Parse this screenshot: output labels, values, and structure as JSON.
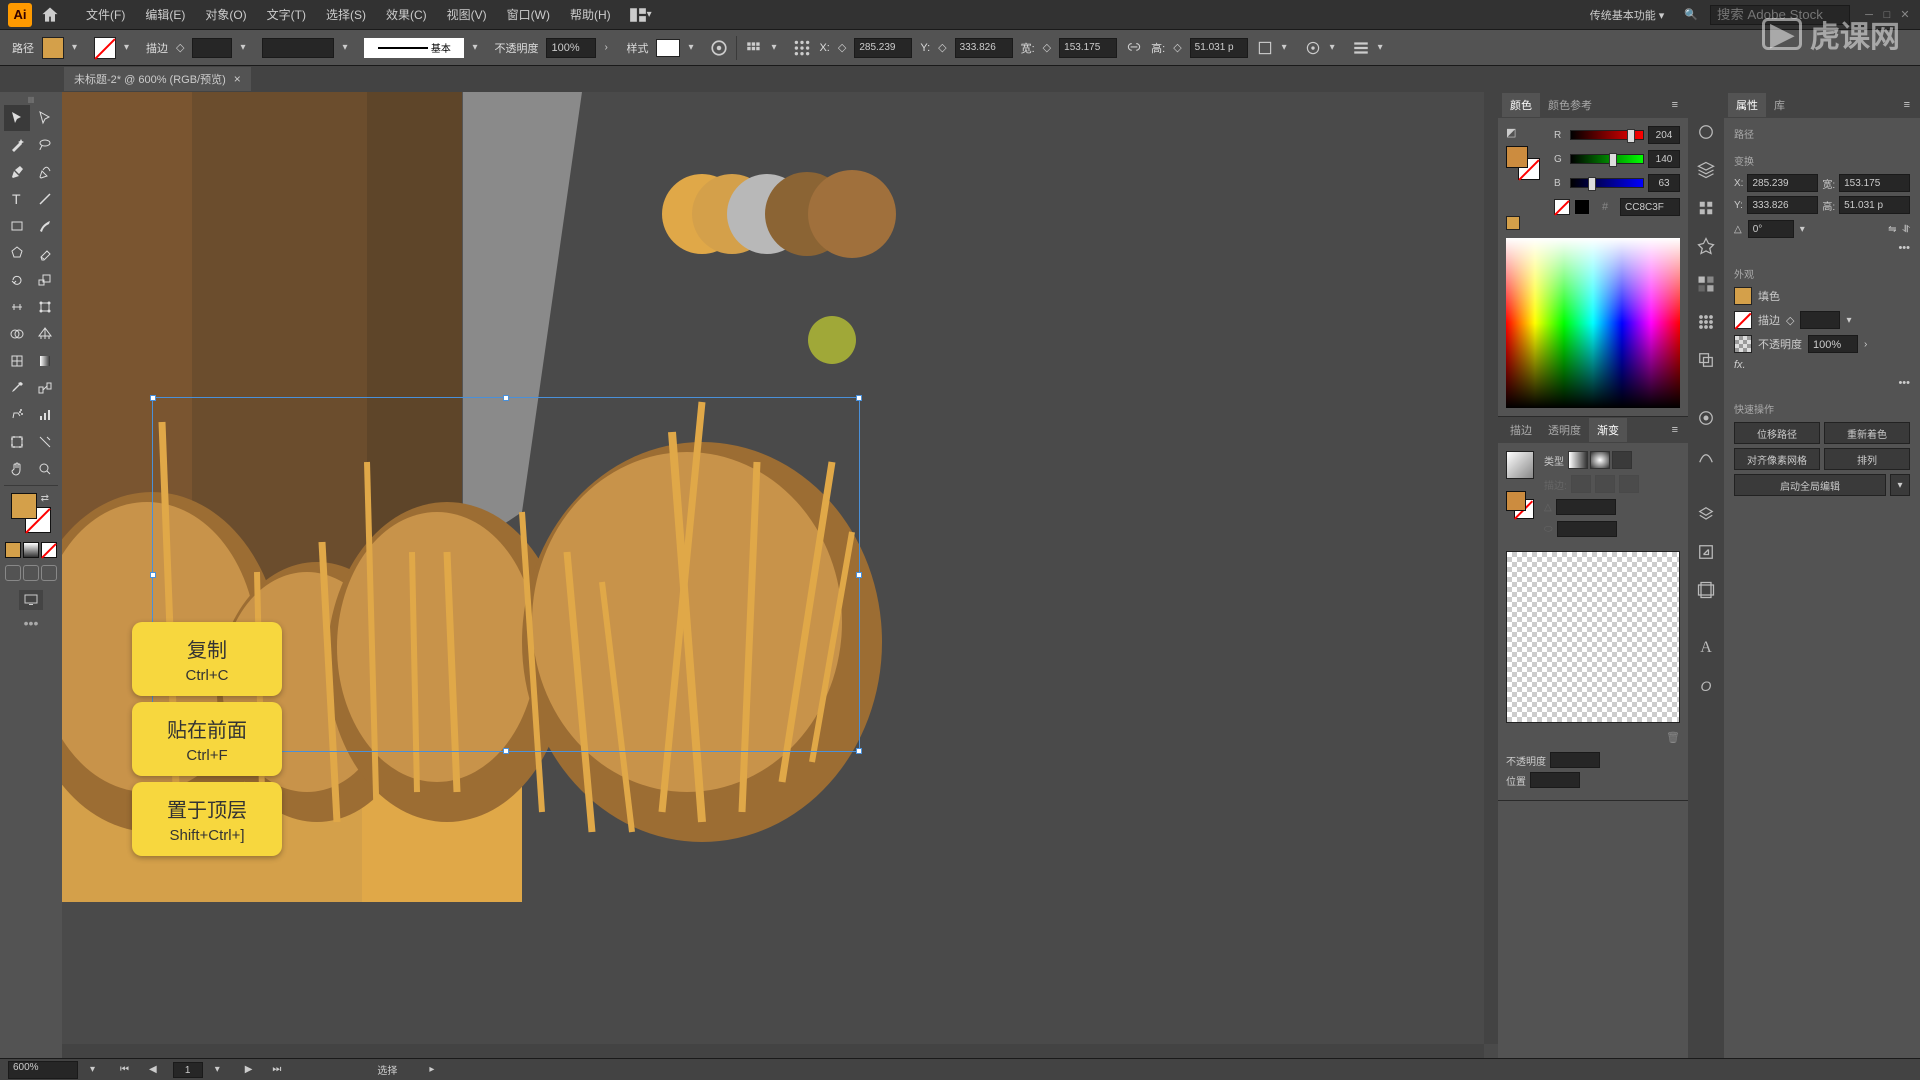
{
  "menubar": {
    "items": [
      "文件(F)",
      "编辑(E)",
      "对象(O)",
      "文字(T)",
      "选择(S)",
      "效果(C)",
      "视图(V)",
      "窗口(W)",
      "帮助(H)"
    ],
    "workspace": "传统基本功能",
    "search_placeholder": "搜索 Adobe Stock"
  },
  "controlbar": {
    "selection_label": "路径",
    "stroke_label": "描边",
    "stroke_weight": "",
    "stroke_style": "基本",
    "opacity_label": "不透明度",
    "opacity": "100%",
    "style_label": "样式",
    "x_label": "X:",
    "x_val": "285.239",
    "y_label": "Y:",
    "y_val": "333.826",
    "w_label": "宽:",
    "w_val": "153.175",
    "h_label": "高:",
    "h_val": "51.031 p"
  },
  "doc_tab": {
    "title": "未标题-2* @ 600% (RGB/预览)"
  },
  "color_panel": {
    "tab1": "颜色",
    "tab2": "颜色参考",
    "r": "204",
    "g": "140",
    "b": "63",
    "hex": "CC8C3F"
  },
  "grad_panel": {
    "tab1": "描边",
    "tab2": "透明度",
    "tab3": "渐变",
    "type_label": "类型",
    "opacity_label": "不透明度",
    "position_label": "位置"
  },
  "props_panel": {
    "tab1": "属性",
    "tab2": "库",
    "selection_type": "路径",
    "transform_label": "变换",
    "x_label": "X:",
    "x_val": "285.239",
    "y_label": "Y:",
    "y_val": "333.826",
    "w_label": "宽:",
    "w_val": "153.175",
    "h_label": "高:",
    "h_val": "51.031 p",
    "angle": "0°",
    "appearance_label": "外观",
    "fill_label": "填色",
    "stroke_label": "描边",
    "opacity_label": "不透明度",
    "opacity": "100%",
    "fx_label": "fx.",
    "quick_actions_label": "快速操作",
    "btn1": "位移路径",
    "btn2": "重新着色",
    "btn3": "对齐像素网格",
    "btn4": "排列",
    "btn5": "启动全局编辑"
  },
  "shortcuts": [
    {
      "title": "复制",
      "key": "Ctrl+C"
    },
    {
      "title": "贴在前面",
      "key": "Ctrl+F"
    },
    {
      "title": "置于顶层",
      "key": "Shift+Ctrl+]"
    }
  ],
  "statusbar": {
    "zoom": "600%",
    "page": "1",
    "tool": "选择"
  },
  "watermark": "虎课网",
  "colors": {
    "fill": "#d4a04a",
    "canvas_bg": "#4a4a4a",
    "bread1": "#d4a04a",
    "bread2": "#b8863f",
    "bread3": "#9c6d33",
    "swatch1": "#e0a848",
    "swatch2": "#d4a04a",
    "swatch3": "#b8b8b8",
    "swatch4": "#8b6434",
    "swatch5": "#a0703c",
    "olive": "#a0a838",
    "bg_left": "#7a5530",
    "bg_mid": "#694a2b",
    "bg_light": "#888888",
    "bg_bottom": "#e0a848"
  }
}
